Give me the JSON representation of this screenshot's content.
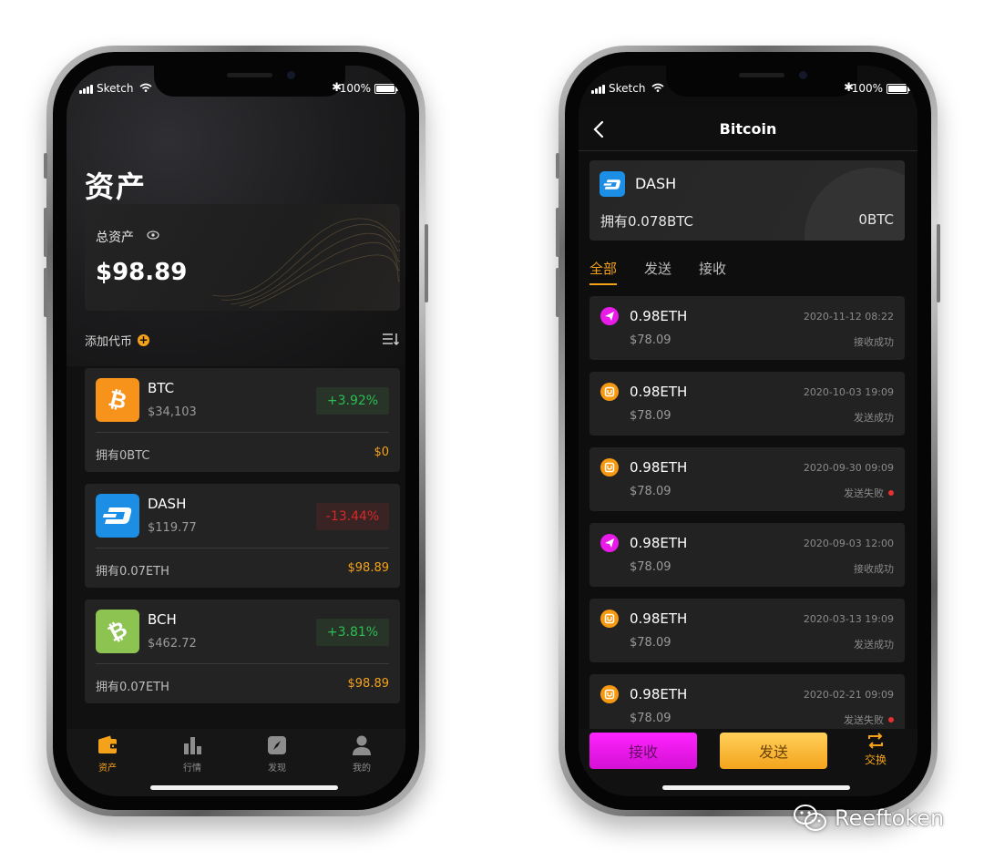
{
  "status_bar": {
    "carrier": "Sketch",
    "battery": "100%"
  },
  "left": {
    "page_title": "资产",
    "total_assets": {
      "label": "总资产",
      "value": "$98.89"
    },
    "add_token_label": "添加代币",
    "coins": [
      {
        "symbol": "BTC",
        "price": "$34,103",
        "change": "+3.92%",
        "direction": "up",
        "holding": "拥有0BTC",
        "fiat": "$0",
        "color": "#f7931a"
      },
      {
        "symbol": "DASH",
        "price": "$119.77",
        "change": "-13.44%",
        "direction": "down",
        "holding": "拥有0.07ETH",
        "fiat": "$98.89",
        "color": "#1c8ee6"
      },
      {
        "symbol": "BCH",
        "price": "$462.72",
        "change": "+3.81%",
        "direction": "up",
        "holding": "拥有0.07ETH",
        "fiat": "$98.89",
        "color": "#8dc351"
      }
    ],
    "tabs": [
      {
        "label": "资产",
        "icon": "wallet-icon",
        "active": true
      },
      {
        "label": "行情",
        "icon": "chart-icon",
        "active": false
      },
      {
        "label": "发现",
        "icon": "compass-icon",
        "active": false
      },
      {
        "label": "我的",
        "icon": "user-icon",
        "active": false
      }
    ]
  },
  "right": {
    "nav_title": "Bitcoin",
    "coin": {
      "name": "DASH",
      "holding": "拥有0.078BTC",
      "value": "0BTC"
    },
    "filter_tabs": [
      "全部",
      "发送",
      "接收"
    ],
    "transactions": [
      {
        "amount": "0.98ETH",
        "fiat": "$78.09",
        "time": "2020-11-12 08:22",
        "status": "接收成功",
        "type": "receive",
        "failed": false
      },
      {
        "amount": "0.98ETH",
        "fiat": "$78.09",
        "time": "2020-10-03 19:09",
        "status": "发送成功",
        "type": "send",
        "failed": false
      },
      {
        "amount": "0.98ETH",
        "fiat": "$78.09",
        "time": "2020-09-30 09:09",
        "status": "发送失败",
        "type": "send",
        "failed": true
      },
      {
        "amount": "0.98ETH",
        "fiat": "$78.09",
        "time": "2020-09-03 12:00",
        "status": "接收成功",
        "type": "receive",
        "failed": false
      },
      {
        "amount": "0.98ETH",
        "fiat": "$78.09",
        "time": "2020-03-13 19:09",
        "status": "发送成功",
        "type": "send",
        "failed": false
      },
      {
        "amount": "0.98ETH",
        "fiat": "$78.09",
        "time": "2020-02-21 09:09",
        "status": "发送失败",
        "type": "send",
        "failed": true
      }
    ],
    "actions": {
      "receive": "接收",
      "send": "发送",
      "swap": "交换"
    }
  },
  "watermark": "Reeftoken",
  "colors": {
    "accent": "#f5a21b",
    "up": "#2dbd52",
    "down": "#d62a2a",
    "receive": "#e81be8",
    "send": "#f59a10"
  }
}
